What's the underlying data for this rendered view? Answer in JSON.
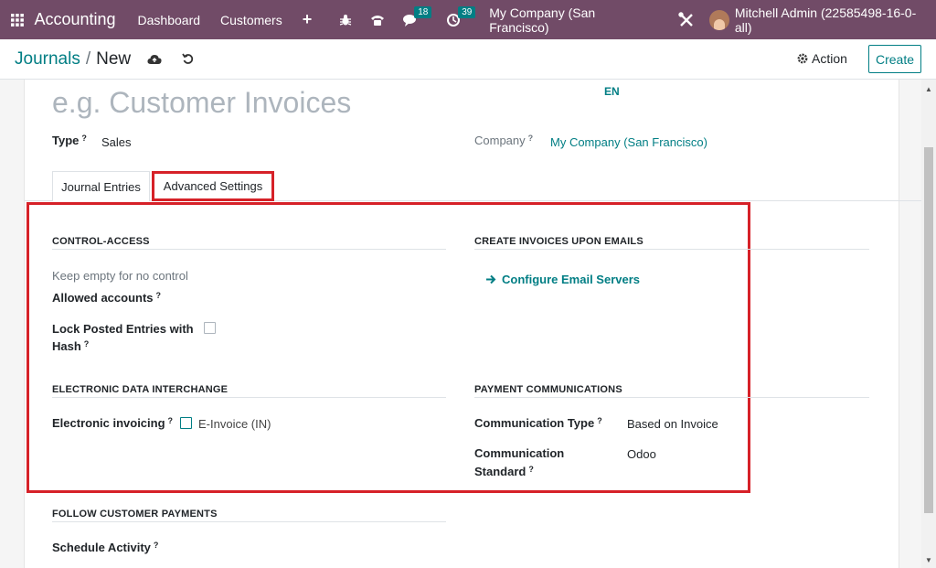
{
  "topnav": {
    "app_name": "Accounting",
    "menu": [
      "Dashboard",
      "Customers"
    ],
    "plus": "+",
    "messages_count": "18",
    "activities_count": "39",
    "company": "My Company (San Francisco)",
    "user": "Mitchell Admin (22585498-16-0-all)"
  },
  "breadcrumb": {
    "parent": "Journals",
    "separator": "/",
    "current": "New"
  },
  "toolbar": {
    "action_label": "Action",
    "create_label": "Create"
  },
  "form": {
    "name_placeholder": "e.g. Customer Invoices",
    "lang": "EN",
    "type_label": "Type",
    "type_value": "Sales",
    "company_label": "Company",
    "company_value": "My Company (San Francisco)",
    "help_mark": "?"
  },
  "tabs": [
    {
      "label": "Journal Entries",
      "active": false
    },
    {
      "label": "Advanced Settings",
      "active": true
    }
  ],
  "control_access": {
    "title": "CONTROL-ACCESS",
    "hint": "Keep empty for no control",
    "allowed_accounts": "Allowed accounts",
    "lock_posted_line1": "Lock Posted Entries with",
    "lock_posted_line2": "Hash"
  },
  "create_invoices": {
    "title": "CREATE INVOICES UPON EMAILS",
    "link": "Configure Email Servers"
  },
  "edi": {
    "title": "ELECTRONIC DATA INTERCHANGE",
    "label": "Electronic invoicing",
    "option": "E-Invoice (IN)"
  },
  "payment_comm": {
    "title": "PAYMENT COMMUNICATIONS",
    "type_label": "Communication Type",
    "type_value": "Based on Invoice",
    "standard_line1": "Communication",
    "standard_line2": "Standard",
    "standard_value": "Odoo"
  },
  "follow": {
    "title": "FOLLOW CUSTOMER PAYMENTS",
    "schedule_label": "Schedule Activity"
  },
  "colors": {
    "brand": "#714b67",
    "accent": "#017e84",
    "highlight": "#d62128"
  }
}
